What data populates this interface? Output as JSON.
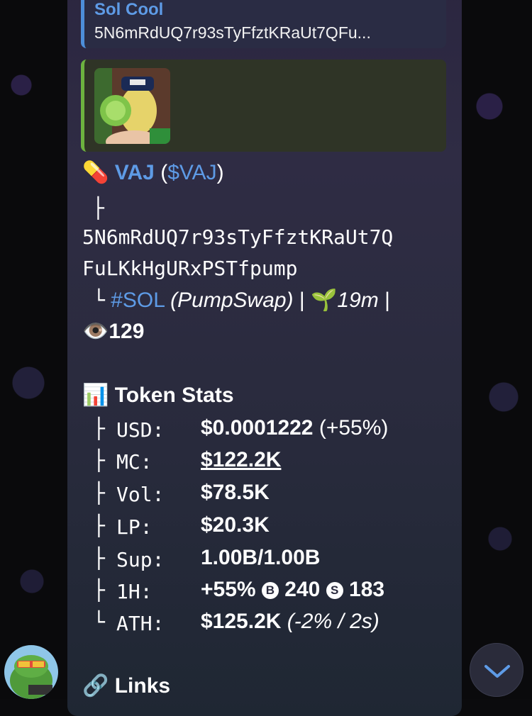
{
  "reply": {
    "name": "Sol Cool",
    "text": "5N6mRdUQ7r93sTyFfztKRaUt7QFu..."
  },
  "token": {
    "emoji": "💊",
    "name": "VAJ",
    "open": "(",
    "ticker": "$VAJ",
    "close": ")",
    "branch1": "├",
    "address_line1": "5N6mRdUQ7r93sTyFfztKRaUt7Q",
    "address_line2": "FuLKkHgURxPSTfpump",
    "branch2": "└",
    "chain": "#SOL",
    "dex": "(PumpSwap)",
    "sep": "|",
    "age_emoji": "🌱",
    "age": "19m",
    "sep2": "|",
    "views_emoji": "👁️",
    "views": "129"
  },
  "stats": {
    "icon": "📊",
    "title": "Token Stats",
    "rows": [
      {
        "branch": "├",
        "key": "USD:",
        "value": "$0.0001222",
        "extra": "(+55%)"
      },
      {
        "branch": "├",
        "key": "MC:",
        "value": "$122.2K"
      },
      {
        "branch": "├",
        "key": "Vol:",
        "value": "$78.5K"
      },
      {
        "branch": "├",
        "key": "LP:",
        "value": "$20.3K"
      },
      {
        "branch": "├",
        "key": "Sup:",
        "value": "1.00B/1.00B"
      },
      {
        "branch": "├",
        "key": "1H:",
        "value": "+55%",
        "b_icon": "B",
        "b_val": "240",
        "s_icon": "S",
        "s_val": "183"
      },
      {
        "branch": "└",
        "key": "ATH:",
        "value": "$125.2K",
        "extra": "(-2% / 2s)"
      }
    ]
  },
  "links": {
    "icon": "🔗",
    "title": "Links"
  },
  "colors": {
    "accent": "#5e9be6",
    "bubble": "#2b2640",
    "media_bar": "#6db33f"
  }
}
